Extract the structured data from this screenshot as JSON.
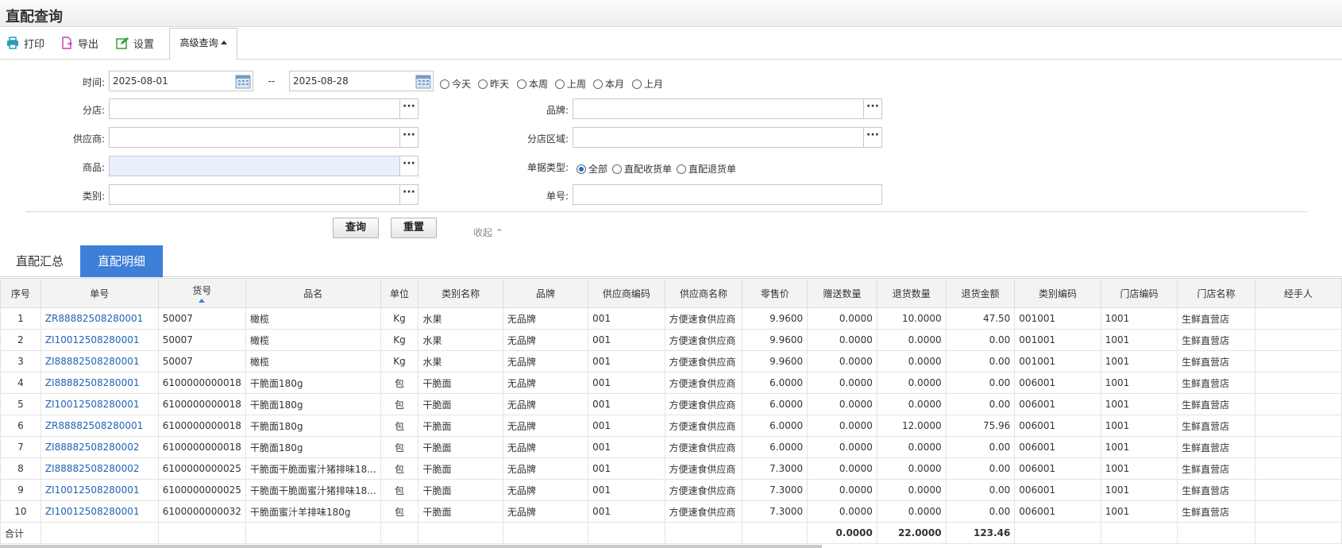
{
  "page": {
    "title": "直配查询"
  },
  "toolbar": {
    "print": "打印",
    "export": "导出",
    "settings": "设置",
    "advanced": "高级查询"
  },
  "filter": {
    "time_label": "时间:",
    "date_from": "2025-08-01",
    "date_sep": "--",
    "date_to": "2025-08-28",
    "quick_dates": [
      "今天",
      "昨天",
      "本周",
      "上周",
      "本月",
      "上月"
    ],
    "store_label": "分店:",
    "brand_label": "品牌:",
    "supplier_label": "供应商:",
    "region_label": "分店区域:",
    "product_label": "商品:",
    "doctype_label": "单据类型:",
    "doctype_options": [
      "全部",
      "直配收货单",
      "直配退货单"
    ],
    "doctype_selected": "全部",
    "category_label": "类别:",
    "docno_label": "单号:",
    "query_button": "查询",
    "reset_button": "重置",
    "collapse": "收起"
  },
  "tabs": [
    "直配汇总",
    "直配明细"
  ],
  "active_tab": "直配明细",
  "table": {
    "columns": [
      "序号",
      "单号",
      "货号",
      "品名",
      "单位",
      "类别名称",
      "品牌",
      "供应商编码",
      "供应商名称",
      "零售价",
      "赠送数量",
      "退货数量",
      "退货金额",
      "类别编码",
      "门店编码",
      "门店名称",
      "经手人"
    ],
    "rows": [
      [
        "1",
        "ZR88882508280001",
        "50007",
        "橄榄",
        "Kg",
        "水果",
        "无品牌",
        "001",
        "方便速食供应商",
        "9.9600",
        "0.0000",
        "10.0000",
        "47.50",
        "001001",
        "1001",
        "生鲜直营店",
        ""
      ],
      [
        "2",
        "ZI10012508280001",
        "50007",
        "橄榄",
        "Kg",
        "水果",
        "无品牌",
        "001",
        "方便速食供应商",
        "9.9600",
        "0.0000",
        "0.0000",
        "0.00",
        "001001",
        "1001",
        "生鲜直营店",
        ""
      ],
      [
        "3",
        "ZI88882508280001",
        "50007",
        "橄榄",
        "Kg",
        "水果",
        "无品牌",
        "001",
        "方便速食供应商",
        "9.9600",
        "0.0000",
        "0.0000",
        "0.00",
        "001001",
        "1001",
        "生鲜直营店",
        ""
      ],
      [
        "4",
        "ZI88882508280001",
        "6100000000018",
        "干脆面180g",
        "包",
        "干脆面",
        "无品牌",
        "001",
        "方便速食供应商",
        "6.0000",
        "0.0000",
        "0.0000",
        "0.00",
        "006001",
        "1001",
        "生鲜直营店",
        ""
      ],
      [
        "5",
        "ZI10012508280001",
        "6100000000018",
        "干脆面180g",
        "包",
        "干脆面",
        "无品牌",
        "001",
        "方便速食供应商",
        "6.0000",
        "0.0000",
        "0.0000",
        "0.00",
        "006001",
        "1001",
        "生鲜直营店",
        ""
      ],
      [
        "6",
        "ZR88882508280001",
        "6100000000018",
        "干脆面180g",
        "包",
        "干脆面",
        "无品牌",
        "001",
        "方便速食供应商",
        "6.0000",
        "0.0000",
        "12.0000",
        "75.96",
        "006001",
        "1001",
        "生鲜直营店",
        ""
      ],
      [
        "7",
        "ZI88882508280002",
        "6100000000018",
        "干脆面180g",
        "包",
        "干脆面",
        "无品牌",
        "001",
        "方便速食供应商",
        "6.0000",
        "0.0000",
        "0.0000",
        "0.00",
        "006001",
        "1001",
        "生鲜直营店",
        ""
      ],
      [
        "8",
        "ZI88882508280002",
        "6100000000025",
        "干脆面干脆面蜜汁猪排味18...",
        "包",
        "干脆面",
        "无品牌",
        "001",
        "方便速食供应商",
        "7.3000",
        "0.0000",
        "0.0000",
        "0.00",
        "006001",
        "1001",
        "生鲜直营店",
        ""
      ],
      [
        "9",
        "ZI10012508280001",
        "6100000000025",
        "干脆面干脆面蜜汁猪排味18...",
        "包",
        "干脆面",
        "无品牌",
        "001",
        "方便速食供应商",
        "7.3000",
        "0.0000",
        "0.0000",
        "0.00",
        "006001",
        "1001",
        "生鲜直营店",
        ""
      ],
      [
        "10",
        "ZI10012508280001",
        "6100000000032",
        "干脆面蜜汁羊排味180g",
        "包",
        "干脆面",
        "无品牌",
        "001",
        "方便速食供应商",
        "7.3000",
        "0.0000",
        "0.0000",
        "0.00",
        "006001",
        "1001",
        "生鲜直营店",
        ""
      ]
    ],
    "total": [
      "合计",
      "",
      "",
      "",
      "",
      "",
      "",
      "",
      "",
      "",
      "0.0000",
      "22.0000",
      "123.46",
      "",
      "",
      "",
      ""
    ]
  },
  "colors": {
    "accent": "#3d7fd9",
    "link": "#1f62b5"
  }
}
